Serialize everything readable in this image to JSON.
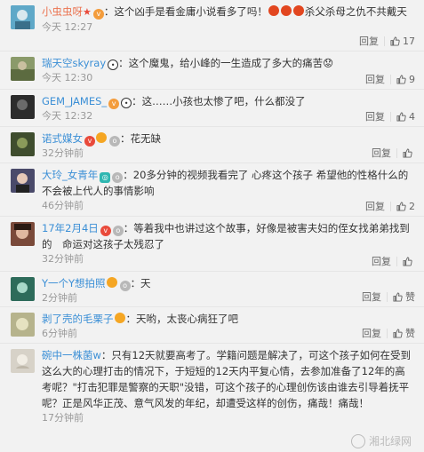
{
  "comments": [
    {
      "user": "小虫虫呀",
      "text": "：这个凶手是看金庸小说看多了吗！",
      "text_tail": "杀父杀母之仇不共戴天",
      "time": "今天 12:27",
      "reply": "回复",
      "likes": "17",
      "avatar_color": "#5fa8c8"
    },
    {
      "user": "瑞天空skyray",
      "text": "：这个魔鬼，给小峰的一生造成了多大的痛苦😟",
      "time": "今天 12:30",
      "reply": "回复",
      "likes": "9",
      "avatar_color": "#8a9a6a"
    },
    {
      "user": "GEM_JAMES_",
      "text": "：这……小孩也太惨了吧，什么都没了",
      "time": "今天 12:32",
      "reply": "回复",
      "likes": "4",
      "avatar_color": "#2c2c2c"
    },
    {
      "user": "诺式媒女",
      "text": "：花无缺",
      "time": "32分钟前",
      "reply": "回复",
      "likes": "",
      "avatar_color": "#3f4d2e"
    },
    {
      "user": "大玲_女青年",
      "text": "：20多分钟的视频我看完了 心疼这个孩子 希望他的性格什么的不会被上代人的事情影响",
      "time": "46分钟前",
      "reply": "回复",
      "likes": "2",
      "avatar_color": "#4a4a6a"
    },
    {
      "user": "17年2月4日",
      "text": "：等着我中也讲过这个故事，好像是被害夫妇的侄女找弟弟找到的　命运对这孩子太残忍了",
      "time": "32分钟前",
      "reply": "回复",
      "likes": "",
      "avatar_color": "#7a4a3a"
    },
    {
      "user": "Y一个Y想拍照",
      "text": "：天",
      "time": "2分钟前",
      "reply": "回复",
      "likes": "赞",
      "avatar_color": "#2d6b5a"
    },
    {
      "user": "剥了壳的毛栗子",
      "text": "：天哟，太丧心病狂了吧",
      "time": "6分钟前",
      "reply": "回复",
      "likes": "赞",
      "avatar_color": "#b6b38c"
    },
    {
      "user": "碗中一株菌w",
      "text": "：只有12天就要高考了。学籍问题是解决了，可这个孩子如何在受到这么大的心理打击的情况下，于短短的12天内平复心情，去参加准备了12年的高考呢？\"打击犯罪是警察的天职\"没错，可这个孩子的心理创伤该由谁去引导着抚平呢？正是风华正茂、意气风发的年纪，却遭受这样的创伤，痛哉！痛哉！",
      "time": "17分钟前",
      "reply": "",
      "likes": "",
      "avatar_color": "#d7d2c8"
    }
  ],
  "watermark": "湘北绿网"
}
